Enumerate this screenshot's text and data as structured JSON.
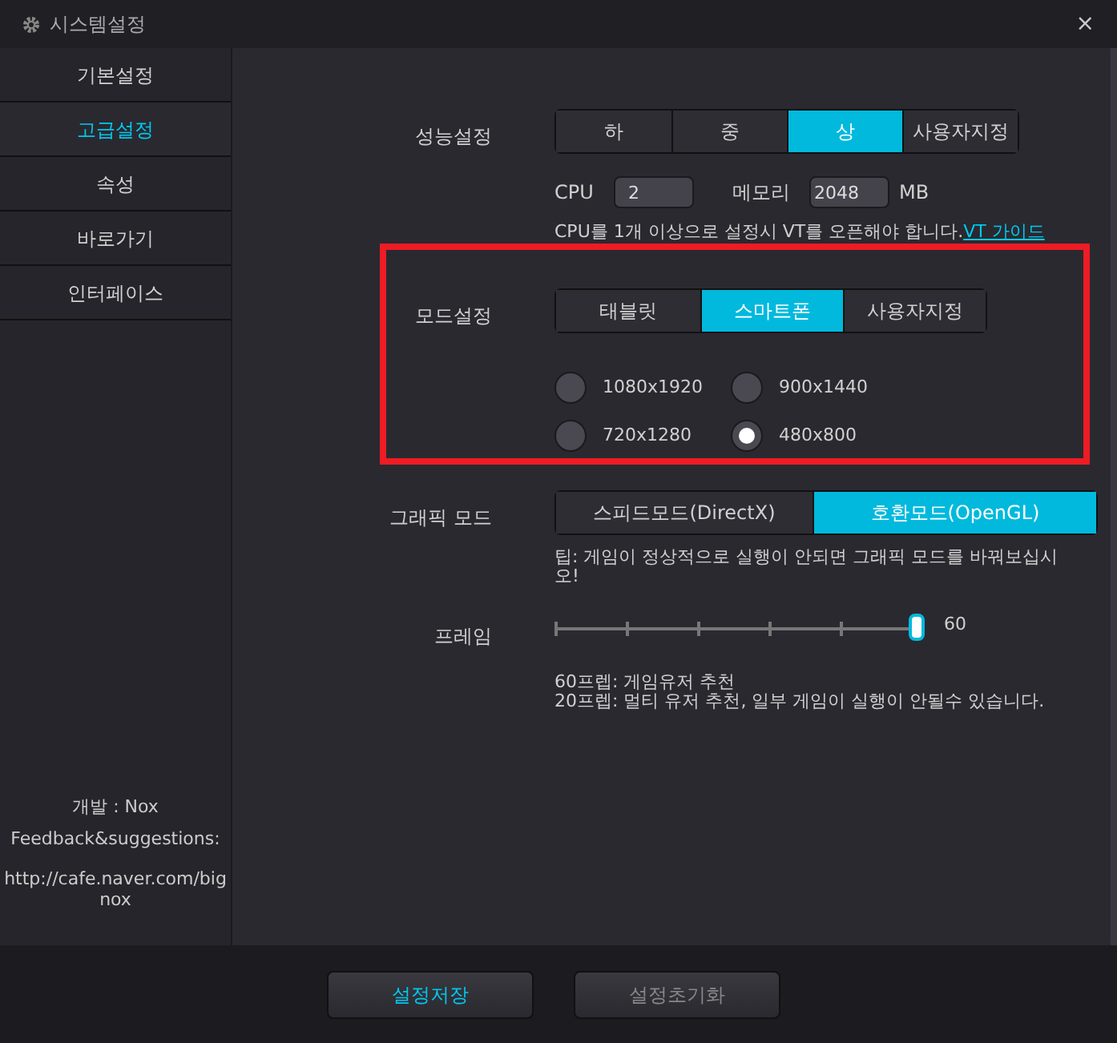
{
  "window": {
    "title": "시스템설정",
    "close": "×"
  },
  "sidebar": {
    "items": [
      {
        "label": "기본설정",
        "selected": false
      },
      {
        "label": "고급설정",
        "selected": true
      },
      {
        "label": "속성",
        "selected": false
      },
      {
        "label": "바로가기",
        "selected": false
      },
      {
        "label": "인터페이스",
        "selected": false
      }
    ],
    "footer": [
      "개발 : Nox",
      "Feedback&suggestions:",
      "http://cafe.naver.com/bignox"
    ]
  },
  "performance": {
    "label": "성능설정",
    "options": [
      {
        "label": "하",
        "selected": false
      },
      {
        "label": "중",
        "selected": false
      },
      {
        "label": "상",
        "selected": true
      },
      {
        "label": "사용자지정",
        "selected": false
      }
    ],
    "cpu_label": "CPU",
    "cpu_value": "2",
    "memory_label": "메모리",
    "memory_value": "2048",
    "memory_unit": "MB",
    "hint": "CPU를 1개 이상으로 설정시 VT를 오픈해야 합니다.",
    "hint_link": "VT 가이드"
  },
  "mode": {
    "label": "모드설정",
    "options": [
      {
        "label": "태블릿",
        "selected": false
      },
      {
        "label": "스마트폰",
        "selected": true
      },
      {
        "label": "사용자지정",
        "selected": false
      }
    ],
    "resolutions": [
      {
        "label": "1080x1920",
        "selected": false
      },
      {
        "label": "900x1440",
        "selected": false
      },
      {
        "label": "720x1280",
        "selected": false
      },
      {
        "label": "480x800",
        "selected": true
      }
    ]
  },
  "graphics": {
    "label": "그래픽 모드",
    "options": [
      {
        "label": "스피드모드(DirectX)",
        "selected": false
      },
      {
        "label": "호환모드(OpenGL)",
        "selected": true
      }
    ],
    "tip": "팁: 게임이 정상적으로 실행이 안되면 그래픽 모드를 바꿔보십시오!"
  },
  "frame": {
    "label": "프레임",
    "level": 1,
    "value": "60",
    "notes": [
      "60프렙: 게임유저 추천",
      "20프렙: 멀티 유저 추천, 일부 게임이 실행이 안될수 있습니다."
    ]
  },
  "buttons": [
    "설정저장",
    "설정초기화"
  ]
}
